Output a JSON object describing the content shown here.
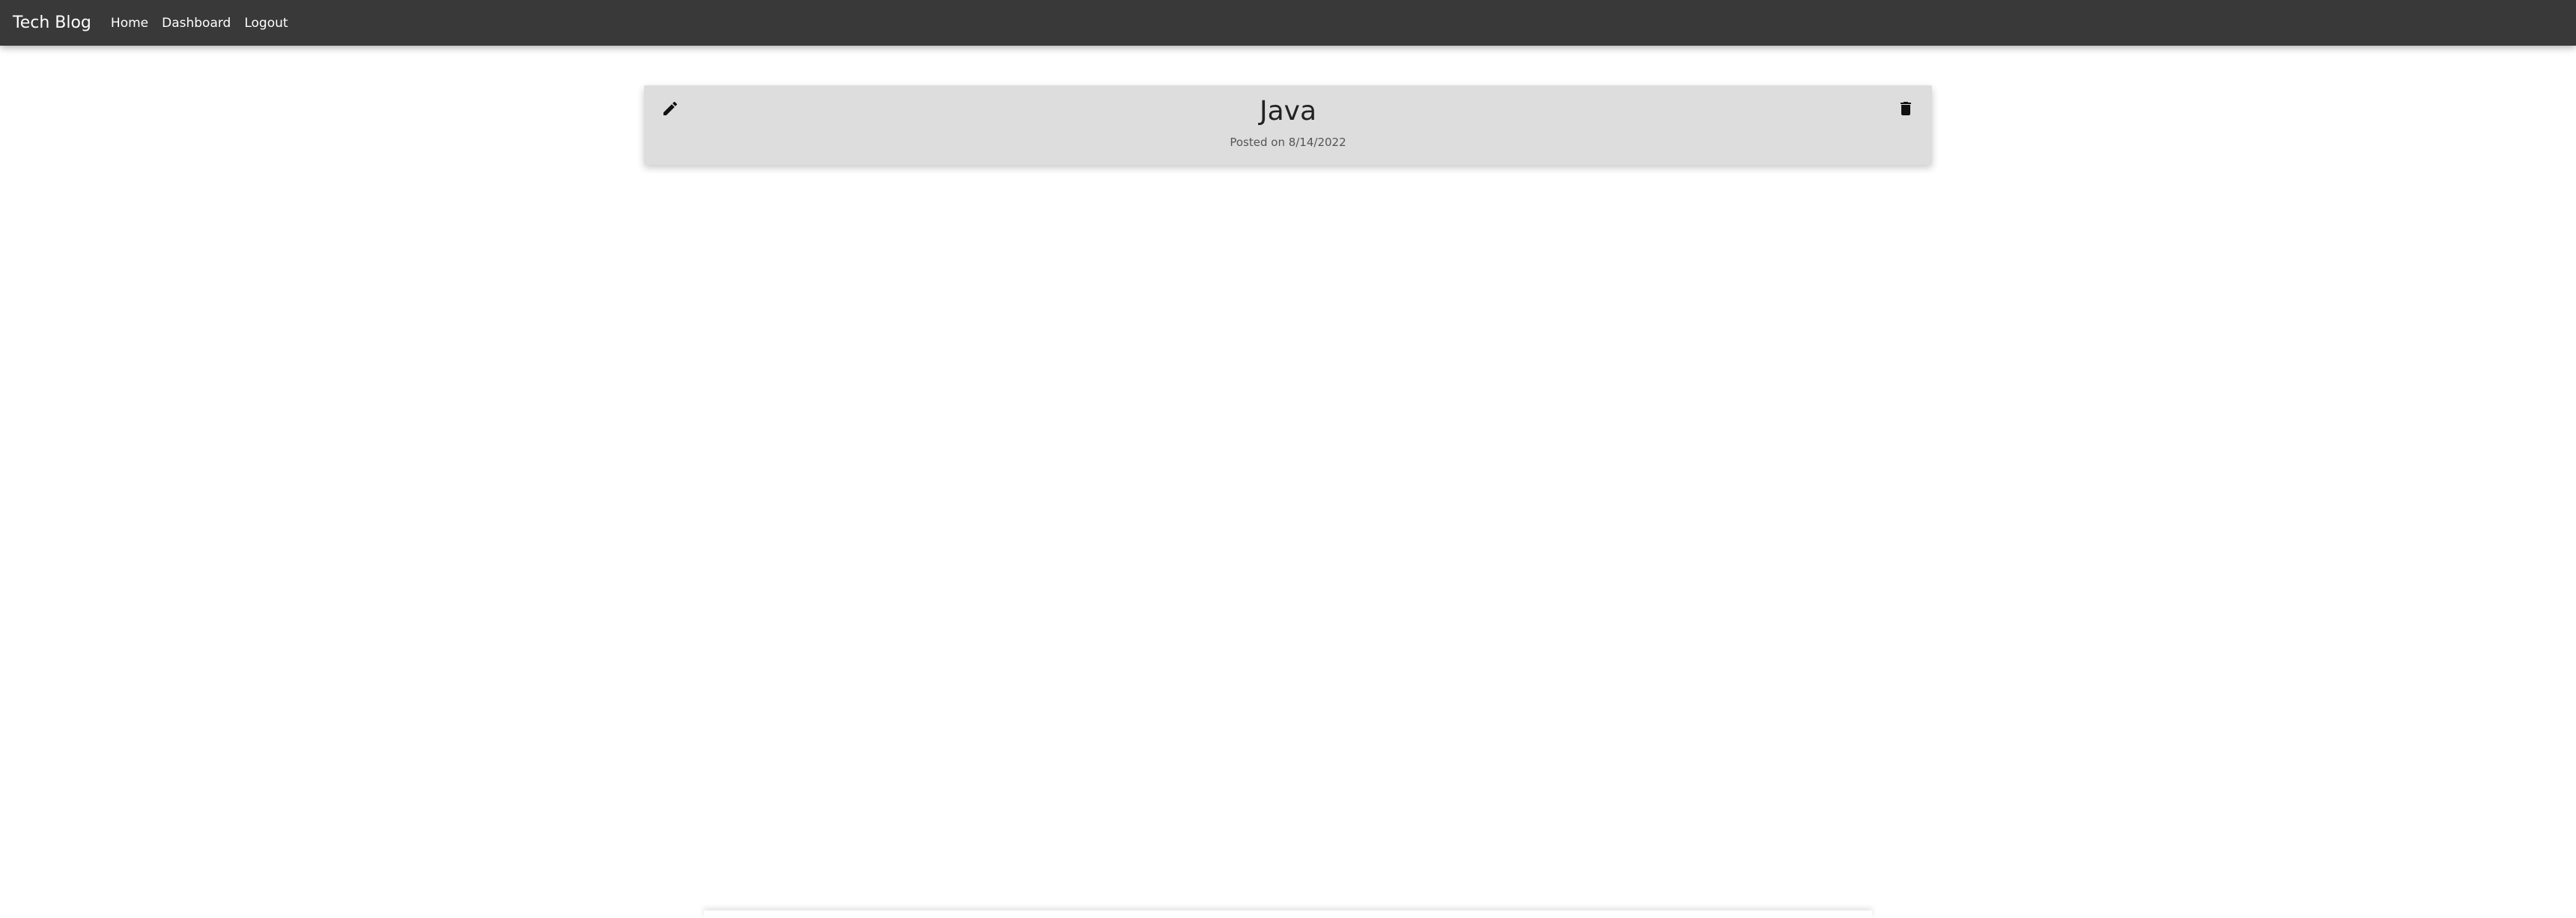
{
  "navbar": {
    "brand": "Tech Blog",
    "links": [
      "Home",
      "Dashboard",
      "Logout"
    ]
  },
  "post": {
    "title": "Java",
    "meta": "Posted on 8/14/2022",
    "edit_icon": "pencil-icon",
    "delete_icon": "trash-icon"
  },
  "colors": {
    "navbar_bg": "#393939",
    "card_bg": "#dddddd",
    "text_light": "#ffffff"
  }
}
